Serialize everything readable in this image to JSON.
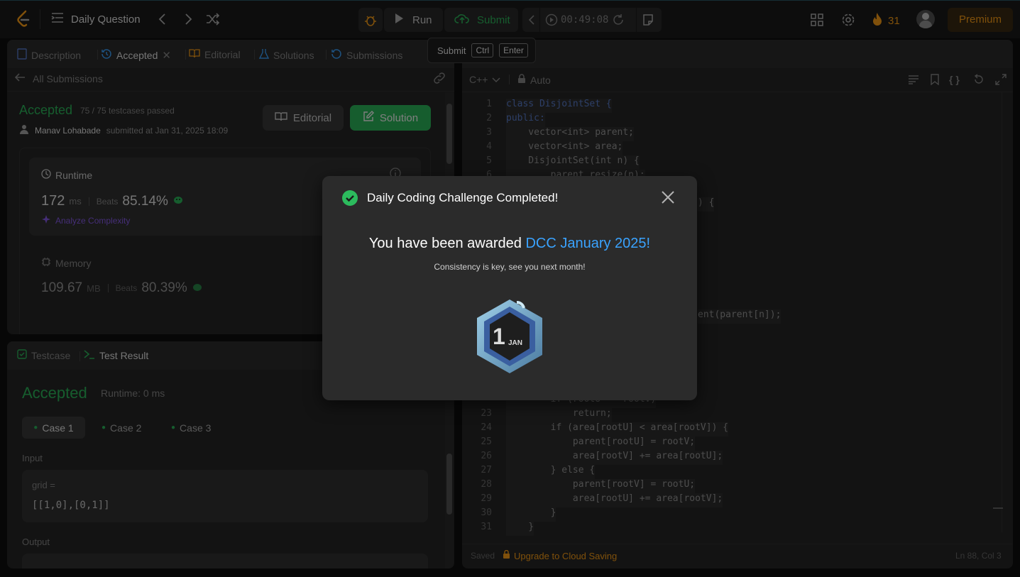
{
  "header": {
    "title": "Daily Question",
    "run_label": "Run",
    "submit_label": "Submit",
    "timer": "00:49:08",
    "streak": "31",
    "premium": "Premium"
  },
  "tooltip": {
    "label": "Submit",
    "key1": "Ctrl",
    "key2": "Enter"
  },
  "left_tabs": {
    "description": "Description",
    "accepted": "Accepted",
    "editorial": "Editorial",
    "solutions": "Solutions",
    "submissions": "Submissions"
  },
  "submission": {
    "back_label": "All Submissions",
    "status": "Accepted",
    "testcases": "75 / 75 testcases passed",
    "author": "Manav Lohabade",
    "submitted_at": "submitted at Jan 31, 2025 18:09",
    "editorial_btn": "Editorial",
    "solution_btn": "Solution",
    "runtime_label": "Runtime",
    "runtime_value": "172",
    "runtime_unit": "ms",
    "beats_label": "Beats",
    "runtime_beats": "85.14%",
    "analyze": "Analyze Complexity",
    "memory_label": "Memory",
    "memory_value": "109.67",
    "memory_unit": "MB",
    "memory_beats": "80.39%"
  },
  "bottom": {
    "testcase_tab": "Testcase",
    "result_tab": "Test Result",
    "status": "Accepted",
    "runtime": "Runtime: 0 ms",
    "cases": [
      "Case 1",
      "Case 2",
      "Case 3"
    ],
    "input_label": "Input",
    "var_name": "grid =",
    "var_value": "[[1,0],[0,1]]",
    "output_label": "Output"
  },
  "editor": {
    "language": "C++",
    "mode": "Auto",
    "saved": "Saved",
    "upgrade": "Upgrade to Cloud Saving",
    "position": "Ln 88, Col 3",
    "lines": [
      {
        "n": "1",
        "code": "class DisjointSet {"
      },
      {
        "n": "2",
        "code": "public:"
      },
      {
        "n": "3",
        "code": "    vector<int> parent;"
      },
      {
        "n": "4",
        "code": "    vector<int> area;"
      },
      {
        "n": "5",
        "code": "    DisjointSet(int n) {"
      },
      {
        "n": "6",
        "code": "        parent.resize(n);"
      }
    ],
    "fragments": {
      "f1": ") {",
      "f2": "ent(parent[n]);",
      "f3": "        if (rootU == rootV)"
    },
    "lines_bottom": [
      {
        "n": "23",
        "code": "            return;"
      },
      {
        "n": "24",
        "code": "        if (area[rootU] < area[rootV]) {"
      },
      {
        "n": "25",
        "code": "            parent[rootU] = rootV;"
      },
      {
        "n": "26",
        "code": "            area[rootV] += area[rootU];"
      },
      {
        "n": "27",
        "code": "        } else {"
      },
      {
        "n": "28",
        "code": "            parent[rootV] = rootU;"
      },
      {
        "n": "29",
        "code": "            area[rootU] += area[rootV];"
      },
      {
        "n": "30",
        "code": "        }"
      },
      {
        "n": "31",
        "code": "    }"
      }
    ]
  },
  "modal": {
    "title": "Daily Coding Challenge Completed!",
    "award_prefix": "You have been awarded ",
    "award_name": "DCC January 2025!",
    "subtitle": "Consistency is key, see you next month!",
    "badge_day": "1",
    "badge_month": "JAN"
  },
  "colors": {
    "accepted": "#2cbb5d",
    "link": "#3aa3ff",
    "submit": "#2cbb5d",
    "streak": "#ffa116",
    "analyze": "#8a5cf0"
  }
}
